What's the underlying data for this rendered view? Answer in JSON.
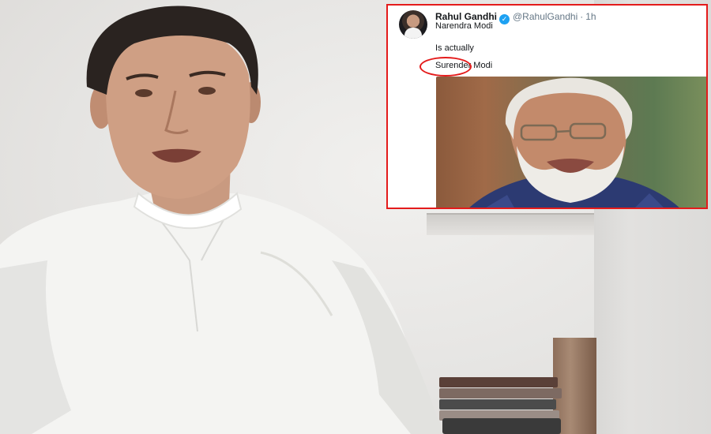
{
  "tweet": {
    "display_name": "Rahul Gandhi",
    "verified_mark": "✓",
    "handle": "@RahulGandhi",
    "separator": "·",
    "time": "1h",
    "line1": "Narendra Modi",
    "line2": "Is actually",
    "line3": "Surender Modi",
    "highlight_color": "#e41b1b"
  },
  "scene": {
    "speaker": "man in white kurta speaking to camera",
    "tweet_photo": "portrait of Narendra Modi"
  }
}
